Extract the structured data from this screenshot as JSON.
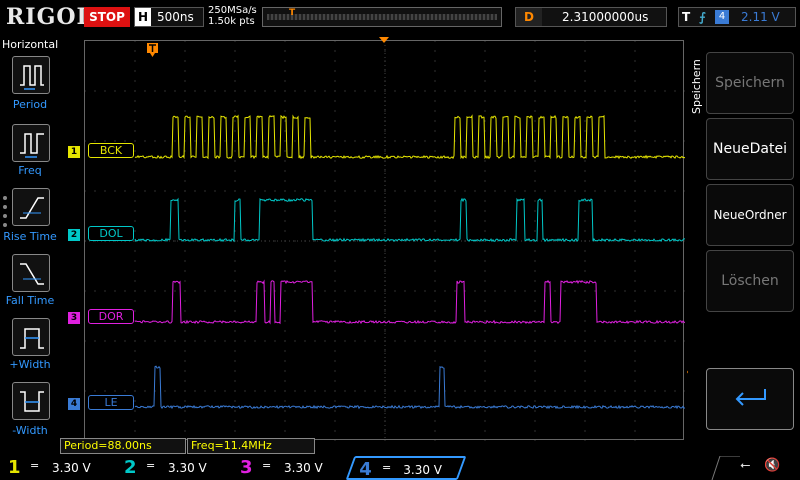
{
  "topbar": {
    "logo": "RIGOL",
    "run_state": "STOP",
    "h_label": "H",
    "timebase": "500ns",
    "sample_rate": "250MSa/s",
    "mem_depth": "1.50k pts",
    "trigger_marker": "T",
    "delay_label": "D",
    "delay_value": "2.31000000us",
    "trig_label": "T",
    "trig_edge": "⨍",
    "trig_source": "4",
    "trig_level": "2.11 V"
  },
  "left_panel": {
    "title": "Horizontal",
    "items": [
      {
        "label": "Period"
      },
      {
        "label": "Freq"
      },
      {
        "label": "Rise Time"
      },
      {
        "label": "Fall Time"
      },
      {
        "label": "+Width"
      },
      {
        "label": "-Width"
      }
    ]
  },
  "channels": [
    {
      "num": "1",
      "label": "BCK",
      "color": "#e6e600",
      "scale": "3.30 V",
      "coupling": "="
    },
    {
      "num": "2",
      "label": "DOL",
      "color": "#00c8c8",
      "scale": "3.30 V",
      "coupling": "="
    },
    {
      "num": "3",
      "label": "DOR",
      "color": "#e020e0",
      "scale": "3.30 V",
      "coupling": "="
    },
    {
      "num": "4",
      "label": "LE",
      "color": "#3a7bd5",
      "scale": "3.30 V",
      "coupling": "="
    }
  ],
  "measurements": {
    "period": "Period=88.00ns",
    "freq": "Freq=11.4MHz"
  },
  "right_panel": {
    "title": "Speichern",
    "buttons": [
      {
        "label": "Speichern"
      },
      {
        "label": "NeueDatei"
      },
      {
        "label": "NeueOrdner"
      },
      {
        "label": "Löschen"
      }
    ]
  },
  "status": {
    "usb": "⭠",
    "speaker": "🔇"
  },
  "colors": {
    "stop": "#dd1111",
    "ch1": "#e6e600",
    "ch2": "#00c8c8",
    "ch3": "#e020e0",
    "ch4": "#3a7bd5",
    "trigger": "#ff8800"
  }
}
